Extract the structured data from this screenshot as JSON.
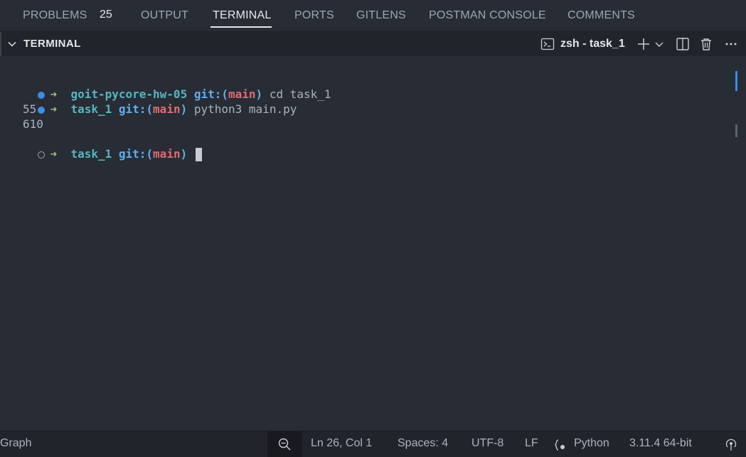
{
  "panel_tabs": {
    "problems": "PROBLEMS",
    "problems_count": "25",
    "output": "OUTPUT",
    "terminal": "TERMINAL",
    "ports": "PORTS",
    "gitlens": "GITLENS",
    "postman": "POSTMAN CONSOLE",
    "comments": "COMMENTS"
  },
  "section": {
    "title": "TERMINAL",
    "terminal_name": "zsh - task_1"
  },
  "terminal_lines": {
    "l1": {
      "arrow": "➜",
      "dir": "goit-pycore-hw-05",
      "git": "git:(",
      "branch": "main",
      "git_close": ")",
      "cmd": " cd task_1"
    },
    "l2": {
      "arrow": "➜",
      "dir": "task_1",
      "git": "git:(",
      "branch": "main",
      "git_close": ")",
      "cmd": " python3 main.py"
    },
    "out1": "55",
    "out2": "610",
    "l5": {
      "arrow": "➜",
      "dir": "task_1",
      "git": "git:(",
      "branch": "main",
      "git_close": ")"
    }
  },
  "statusbar": {
    "graph": "Graph",
    "position": "Ln 26, Col 1",
    "spaces": "Spaces: 4",
    "encoding": "UTF-8",
    "eol": "LF",
    "language": "Python",
    "interpreter": "3.11.4 64-bit"
  },
  "colors": {
    "accent": "#3b8eea",
    "background": "#282c34",
    "statusbar": "#21252b"
  }
}
